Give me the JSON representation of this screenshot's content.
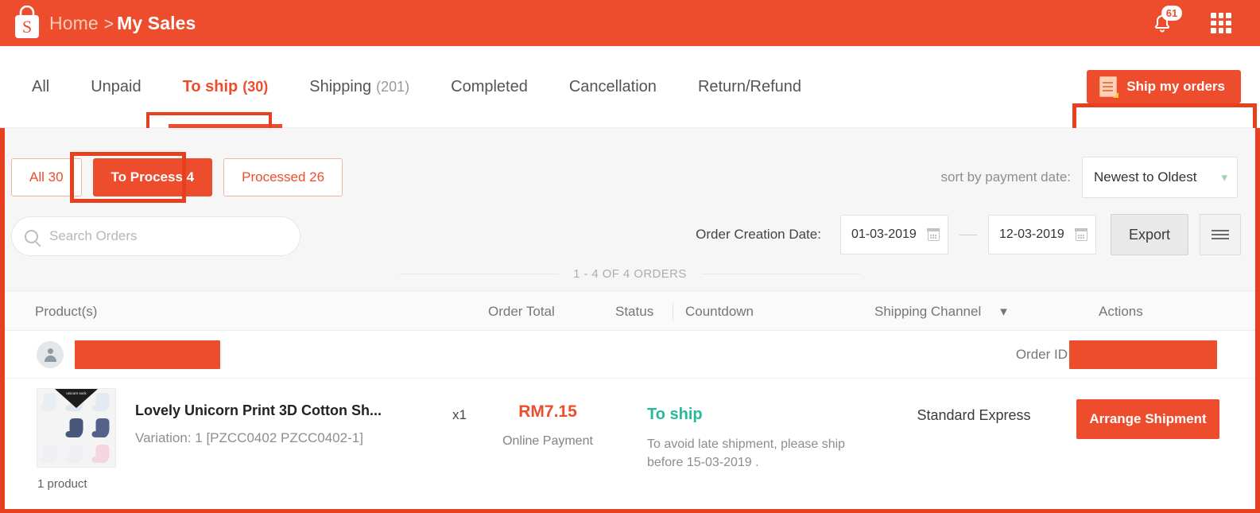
{
  "topbar": {
    "logo_icon": "shopee-bag-icon",
    "breadcrumb_home": "Home",
    "breadcrumb_sep": ">",
    "breadcrumb_current": "My Sales",
    "bell_icon": "notification-bell-icon",
    "bell_badge": "61",
    "apps_icon": "apps-grid-icon",
    "background": "#ee4d2d"
  },
  "tabs": [
    {
      "label": "All",
      "count": ""
    },
    {
      "label": "Unpaid",
      "count": ""
    },
    {
      "label": "To ship",
      "count": "(30)"
    },
    {
      "label": "Shipping",
      "count": "(201)"
    },
    {
      "label": "Completed",
      "count": ""
    },
    {
      "label": "Cancellation",
      "count": ""
    },
    {
      "label": "Return/Refund",
      "count": ""
    }
  ],
  "ship_button": {
    "label": "Ship my orders",
    "icon": "invoice-document-icon",
    "color": "#ee4d2d"
  },
  "filters": {
    "chips": [
      {
        "label": "All 30",
        "active": false
      },
      {
        "label": "To Process 4",
        "active": true
      },
      {
        "label": "Processed 26",
        "active": false
      }
    ]
  },
  "sort": {
    "label": "sort by payment date:",
    "value": "Newest to Oldest",
    "chevron_icon": "chevron-down-icon"
  },
  "search": {
    "placeholder": "Search Orders",
    "icon": "search-icon",
    "value": ""
  },
  "date_filter": {
    "label": "Order Creation Date:",
    "from": "01-03-2019",
    "to": "12-03-2019",
    "separator": "—",
    "calendar_icon": "calendar-icon"
  },
  "toolbar": {
    "export_label": "Export",
    "list_view_icon": "hamburger-list-icon"
  },
  "order_count": "1 - 4 OF 4 ORDERS",
  "table": {
    "headers": {
      "product": "Product(s)",
      "order_total": "Order Total",
      "status": "Status",
      "countdown": "Countdown",
      "shipping_channel": "Shipping Channel",
      "shipping_channel_chevron": "chevron-down-icon",
      "actions": "Actions"
    },
    "buyer_row": {
      "avatar_icon": "user-avatar-icon",
      "buyer_name": "",
      "buyer_name_redacted": true,
      "order_id_label": "Order ID",
      "order_id": "",
      "order_id_redacted": true,
      "redaction_color": "#ee4d2d"
    },
    "order": {
      "product_thumbnail_icon": "product-thumbnail-socks",
      "product_count_label": "1 product",
      "product_title": "Lovely Unicorn Print 3D Cotton Sh...",
      "product_variation": "Variation: 1 [PZCC0402 PZCC0402-1]",
      "quantity": "x1",
      "order_total": "RM7.15",
      "payment_method": "Online Payment",
      "status": "To ship",
      "status_color": "#26b99a",
      "countdown_note": "To avoid late shipment, please ship before 15-03-2019 .",
      "shipping_channel": "Standard Express",
      "action_label": "Arrange Shipment"
    }
  },
  "annotations": {
    "highlight_color": "#e8401f",
    "boxes": [
      "to-ship-tab",
      "ship-my-orders-button",
      "to-process-chip",
      "content-area"
    ]
  }
}
